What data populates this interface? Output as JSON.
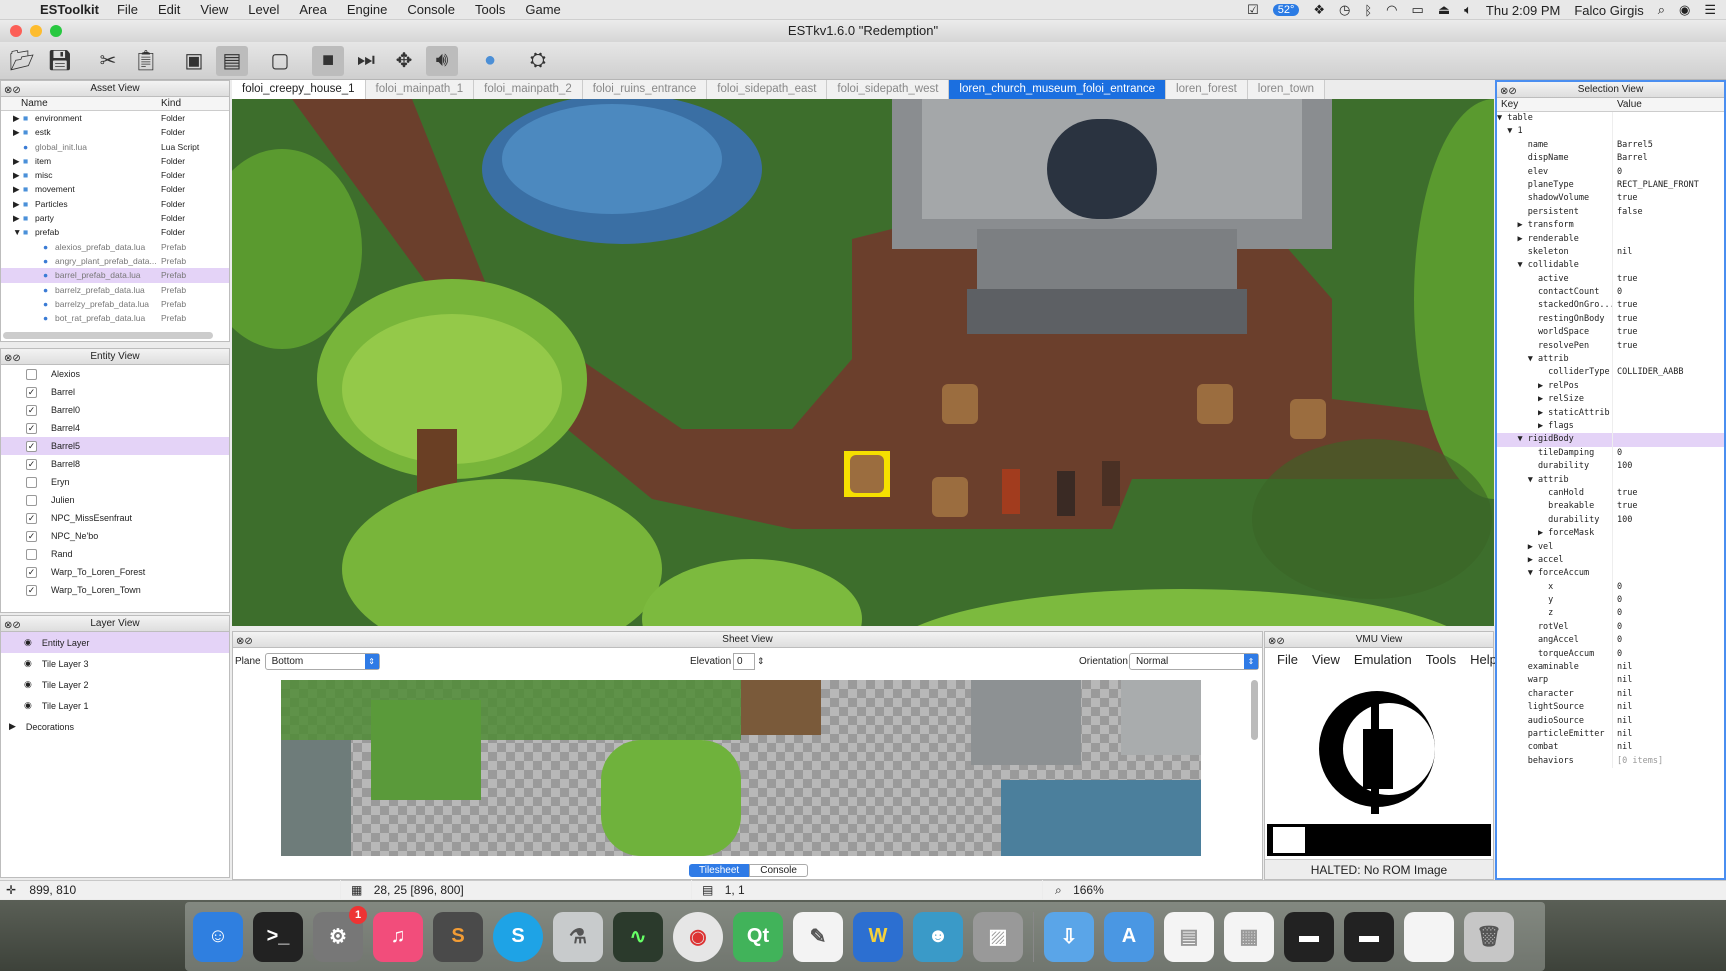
{
  "menubar": {
    "app_name": "ESToolkit",
    "items": [
      "File",
      "Edit",
      "View",
      "Level",
      "Area",
      "Engine",
      "Console",
      "Tools",
      "Game"
    ],
    "battery": "52°",
    "clock": "Thu 2:09 PM",
    "user": "Falco Girgis"
  },
  "window": {
    "title": "ESTkv1.6.0 \"Redemption\""
  },
  "toolbar": {
    "icons": [
      "open-folder-icon",
      "save-icon",
      "cut-icon",
      "paste-icon",
      "monitor-icon",
      "window-icon",
      "screen-icon",
      "square-icon",
      "step-icon",
      "move-icon",
      "sound-icon",
      "apple-icon",
      "hat-icon"
    ]
  },
  "asset_view": {
    "title": "Asset View",
    "col_name": "Name",
    "col_kind": "Kind",
    "rows": [
      {
        "name": "environment",
        "kind": "Folder"
      },
      {
        "name": "estk",
        "kind": "Folder"
      },
      {
        "name": "global_init.lua",
        "kind": "Lua Script"
      },
      {
        "name": "item",
        "kind": "Folder"
      },
      {
        "name": "misc",
        "kind": "Folder"
      },
      {
        "name": "movement",
        "kind": "Folder"
      },
      {
        "name": "Particles",
        "kind": "Folder"
      },
      {
        "name": "party",
        "kind": "Folder"
      },
      {
        "name": "prefab",
        "kind": "Folder"
      },
      {
        "name": "alexios_prefab_data.lua",
        "kind": "Prefab"
      },
      {
        "name": "angry_plant_prefab_data...",
        "kind": "Prefab"
      },
      {
        "name": "barrel_prefab_data.lua",
        "kind": "Prefab"
      },
      {
        "name": "barrelz_prefab_data.lua",
        "kind": "Prefab"
      },
      {
        "name": "barrelzy_prefab_data.lua",
        "kind": "Prefab"
      },
      {
        "name": "bot_rat_prefab_data.lua",
        "kind": "Prefab"
      }
    ]
  },
  "entity_view": {
    "title": "Entity View",
    "rows": [
      {
        "name": "Alexios",
        "checked": ""
      },
      {
        "name": "Barrel",
        "checked": "✓"
      },
      {
        "name": "Barrel0",
        "checked": "✓"
      },
      {
        "name": "Barrel4",
        "checked": "✓"
      },
      {
        "name": "Barrel5",
        "checked": "✓"
      },
      {
        "name": "Barrel8",
        "checked": "✓"
      },
      {
        "name": "Eryn",
        "checked": ""
      },
      {
        "name": "Julien",
        "checked": ""
      },
      {
        "name": "NPC_MissEsenfraut",
        "checked": "✓"
      },
      {
        "name": "NPC_Ne'bo",
        "checked": "✓"
      },
      {
        "name": "Rand",
        "checked": ""
      },
      {
        "name": "Warp_To_Loren_Forest",
        "checked": "✓"
      },
      {
        "name": "Warp_To_Loren_Town",
        "checked": "✓"
      }
    ]
  },
  "layer_view": {
    "title": "Layer View",
    "rows": [
      "Entity Layer",
      "Tile Layer 3",
      "Tile Layer 2",
      "Tile Layer 1"
    ],
    "group": "Decorations"
  },
  "tabs": [
    "foloi_creepy_house_1",
    "foloi_mainpath_1",
    "foloi_mainpath_2",
    "foloi_ruins_entrance",
    "foloi_sidepath_east",
    "foloi_sidepath_west",
    "loren_church_museum_foloi_entrance",
    "loren_forest",
    "loren_town"
  ],
  "sheet_view": {
    "title": "Sheet View",
    "plane_label": "Plane",
    "plane_value": "Bottom",
    "elevation_label": "Elevation",
    "elevation_value": "0",
    "orientation_label": "Orientation",
    "orientation_value": "Normal",
    "tab_tilesheet": "Tilesheet",
    "tab_console": "Console"
  },
  "vmu_view": {
    "title": "VMU View",
    "menu": [
      "File",
      "View",
      "Emulation",
      "Tools",
      "Help"
    ],
    "status": "HALTED: No ROM Image"
  },
  "selection_view": {
    "title": "Selection View",
    "col_key": "Key",
    "col_value": "Value",
    "rows": [
      {
        "k": "▼ table",
        "v": ""
      },
      {
        "k": "  ▼ 1",
        "v": ""
      },
      {
        "k": "      name",
        "v": "Barrel5"
      },
      {
        "k": "      dispName",
        "v": "Barrel"
      },
      {
        "k": "      elev",
        "v": "0"
      },
      {
        "k": "      planeType",
        "v": "RECT_PLANE_FRONT"
      },
      {
        "k": "      shadowVolume",
        "v": "true"
      },
      {
        "k": "      persistent",
        "v": "false"
      },
      {
        "k": "    ▶ transform",
        "v": ""
      },
      {
        "k": "    ▶ renderable",
        "v": ""
      },
      {
        "k": "      skeleton",
        "v": "nil"
      },
      {
        "k": "    ▼ collidable",
        "v": ""
      },
      {
        "k": "        active",
        "v": "true"
      },
      {
        "k": "        contactCount",
        "v": "0"
      },
      {
        "k": "        stackedOnGro...",
        "v": "true"
      },
      {
        "k": "        restingOnBody",
        "v": "true"
      },
      {
        "k": "        worldSpace",
        "v": "true"
      },
      {
        "k": "        resolvePen",
        "v": "true"
      },
      {
        "k": "      ▼ attrib",
        "v": ""
      },
      {
        "k": "          colliderType",
        "v": "COLLIDER_AABB"
      },
      {
        "k": "        ▶ relPos",
        "v": ""
      },
      {
        "k": "        ▶ relSize",
        "v": ""
      },
      {
        "k": "        ▶ staticAttrib",
        "v": ""
      },
      {
        "k": "        ▶ flags",
        "v": ""
      },
      {
        "k": "    ▼ rigidBody",
        "v": ""
      },
      {
        "k": "        tileDamping",
        "v": "0"
      },
      {
        "k": "        durability",
        "v": "100"
      },
      {
        "k": "      ▼ attrib",
        "v": ""
      },
      {
        "k": "          canHold",
        "v": "true"
      },
      {
        "k": "          breakable",
        "v": "true"
      },
      {
        "k": "          durability",
        "v": "100"
      },
      {
        "k": "        ▶ forceMask",
        "v": ""
      },
      {
        "k": "      ▶ vel",
        "v": ""
      },
      {
        "k": "      ▶ accel",
        "v": ""
      },
      {
        "k": "      ▼ forceAccum",
        "v": ""
      },
      {
        "k": "          x",
        "v": "0"
      },
      {
        "k": "          y",
        "v": "0"
      },
      {
        "k": "          z",
        "v": "0"
      },
      {
        "k": "        rotVel",
        "v": "0"
      },
      {
        "k": "        angAccel",
        "v": "0"
      },
      {
        "k": "        torqueAccum",
        "v": "0"
      },
      {
        "k": "      examinable",
        "v": "nil"
      },
      {
        "k": "      warp",
        "v": "nil"
      },
      {
        "k": "      character",
        "v": "nil"
      },
      {
        "k": "      lightSource",
        "v": "nil"
      },
      {
        "k": "      audioSource",
        "v": "nil"
      },
      {
        "k": "      particleEmitter",
        "v": "nil"
      },
      {
        "k": "      combat",
        "v": "nil"
      },
      {
        "k": "      behaviors",
        "v": "[0 items]"
      }
    ]
  },
  "status": {
    "cursor": "899, 810",
    "tile": "28, 25 [896, 800]",
    "sheet_pos": "1, 1",
    "zoom": "166%"
  },
  "dock": {
    "notification_count": "1",
    "apps": [
      "finder-icon",
      "terminal-icon",
      "system-prefs-icon",
      "itunes-icon",
      "sublime-icon",
      "skype-icon",
      "python-icon",
      "activity-icon",
      "chrome-icon",
      "qt-icon",
      "textedit-icon",
      "qw-icon",
      "game-char-icon",
      "preview-icon",
      "downloads-icon",
      "appstore-icon",
      "doc-icon",
      "doc-icon",
      "screen-icon",
      "screen-icon",
      "screen-icon",
      "trash-icon"
    ]
  }
}
